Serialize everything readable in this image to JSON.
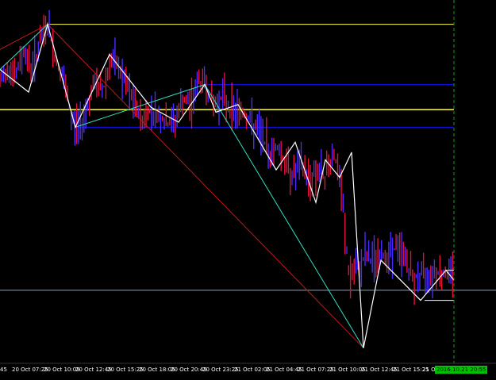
{
  "colors": {
    "background": "#000000",
    "candle_up": "#4a2cff",
    "candle_down": "#e0103a",
    "zigzag": "#ffffff",
    "fib_line": "#30e0c0",
    "diag_red": "#c01818",
    "level_yellow": "#ffff40",
    "level_blue": "#1010ff",
    "hline_gray": "#8fa0b0",
    "vline_green": "#10a010",
    "time_badge": "#00c000"
  },
  "axis": {
    "time_labels": [
      "45",
      "20 Oct 07:25",
      "20 Oct 10:05",
      "20 Oct 12:45",
      "20 Oct 15:25",
      "20 Oct 18:05",
      "20 Oct 20:45",
      "20 Oct 23:25",
      "21 Oct 02:05",
      "21 Oct 04:45",
      "21 Oct 07:25",
      "21 Oct 10:05",
      "21 Oct 12:45",
      "21 Oct 15:25",
      "21 Oct",
      "45"
    ],
    "current_time_badge": "2016.10.21 20:55"
  },
  "chart_data": {
    "type": "line",
    "description_hidden": "",
    "x": [
      0,
      10,
      20,
      30,
      40,
      50,
      60,
      70,
      80,
      90,
      100,
      110,
      120,
      130,
      140,
      150,
      160,
      170,
      180,
      190,
      200,
      210,
      220,
      230,
      240,
      250,
      260,
      270,
      280,
      290,
      300,
      310,
      320,
      330,
      340,
      350,
      360,
      370,
      380,
      390,
      400,
      410,
      420,
      430,
      440,
      450,
      460,
      470,
      480,
      490,
      500,
      510,
      520,
      530,
      540,
      550,
      560,
      570
    ],
    "series": [
      {
        "values": [
          0.72,
          0.8,
          0.75,
          0.86,
          0.78,
          0.88,
          0.96,
          0.82,
          0.74,
          0.58,
          0.55,
          0.64,
          0.72,
          0.7,
          0.82,
          0.78,
          0.71,
          0.63,
          0.58,
          0.62,
          0.6,
          0.56,
          0.57,
          0.65,
          0.64,
          0.73,
          0.72,
          0.63,
          0.68,
          0.62,
          0.62,
          0.6,
          0.55,
          0.52,
          0.44,
          0.48,
          0.4,
          0.36,
          0.4,
          0.34,
          0.38,
          0.35,
          0.46,
          0.3,
          -0.05,
          -0.02,
          0.04,
          0.02,
          0.03,
          0.05,
          0.07,
          0.04,
          -0.06,
          -0.04,
          -0.03,
          -0.02,
          -0.04,
          -0.03
        ]
      }
    ],
    "zigzag_points": [
      [
        0,
        0.78
      ],
      [
        36,
        0.69
      ],
      [
        60,
        0.96
      ],
      [
        95,
        0.55
      ],
      [
        138,
        0.84
      ],
      [
        190,
        0.63
      ],
      [
        225,
        0.57
      ],
      [
        258,
        0.72
      ],
      [
        272,
        0.61
      ],
      [
        300,
        0.64
      ],
      [
        348,
        0.38
      ],
      [
        372,
        0.49
      ],
      [
        398,
        0.25
      ],
      [
        410,
        0.42
      ],
      [
        428,
        0.35
      ],
      [
        443,
        0.45
      ],
      [
        458,
        -0.33
      ],
      [
        480,
        0.02
      ],
      [
        530,
        -0.14
      ],
      [
        562,
        -0.02
      ],
      [
        572,
        -0.06
      ]
    ],
    "levels": [
      {
        "name": "top",
        "value": 0.96
      },
      {
        "name": "upper",
        "value": 0.72
      },
      {
        "name": "mid",
        "value": 0.62
      },
      {
        "name": "lower",
        "value": 0.55
      },
      {
        "name": "current",
        "value": -0.1
      }
    ],
    "ylim": [
      -0.35,
      1.0
    ],
    "grid": false
  }
}
